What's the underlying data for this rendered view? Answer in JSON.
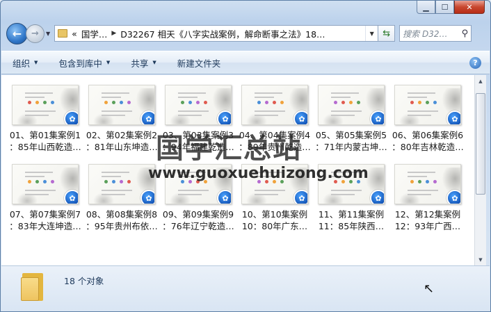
{
  "window": {
    "caption": {
      "minimize": "▁",
      "maximize": "☐",
      "close": "✕"
    }
  },
  "nav": {
    "back_icon": "arrow-left-icon",
    "forward_icon": "arrow-right-icon",
    "address": {
      "overflow": "«",
      "crumb1": "国学…",
      "crumb2": "D32267 相天《八字实战案例，解命断事之法》18…"
    },
    "search_placeholder": "搜索 D32…"
  },
  "toolbar": {
    "organize": "组织",
    "include": "包含到库中",
    "share": "共享",
    "new_folder": "新建文件夹"
  },
  "files": [
    {
      "line1": "01、第01集案例1",
      "line2": "：85年山西乾造…"
    },
    {
      "line1": "02、第02集案例2",
      "line2": "：81年山东坤造…"
    },
    {
      "line1": "03、第03集案例3",
      "line2": "：94年福建乾造…"
    },
    {
      "line1": "04、第04集案例4",
      "line2": "：89年贵州乾造…"
    },
    {
      "line1": "05、第05集案例5",
      "line2": "：71年内蒙古坤…"
    },
    {
      "line1": "06、第06集案例6",
      "line2": "：80年吉林乾造…"
    },
    {
      "line1": "07、第07集案例7",
      "line2": "：83年大连坤造…"
    },
    {
      "line1": "08、第08集案例8",
      "line2": "：95年贵州布依…"
    },
    {
      "line1": "09、第09集案例9",
      "line2": "：76年辽宁乾造…"
    },
    {
      "line1": "10、第10集案例",
      "line2": "10：80年广东…"
    },
    {
      "line1": "11、第11集案例",
      "line2": "11：85年陕西…"
    },
    {
      "line1": "12、第12集案例",
      "line2": "12：93年广西…"
    }
  ],
  "watermark": {
    "cn": "国学汇总站",
    "en": "www.guoxuehuizong.com"
  },
  "details": {
    "count": "18 个对象"
  }
}
